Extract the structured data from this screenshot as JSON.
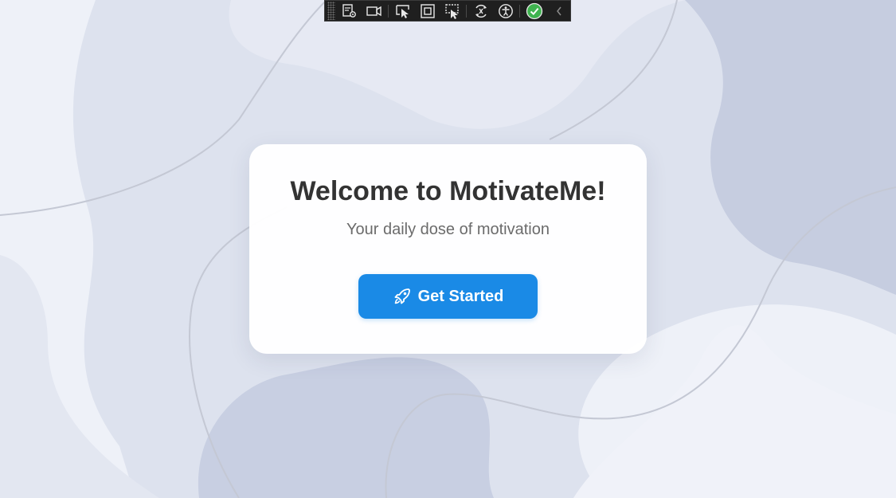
{
  "devtools": {
    "icons": [
      "live-visual-tree-icon",
      "video-capture-icon",
      "select-element-icon",
      "display-layout-adorners-icon",
      "track-focus-icon",
      "hot-reload-icon",
      "accessibility-checker-icon",
      "issues-ok-icon",
      "collapse-toolbar-icon"
    ]
  },
  "card": {
    "title": "Welcome to MotivateMe!",
    "subtitle": "Your daily dose of motivation",
    "button_label": "Get Started",
    "button_icon": "rocket-icon"
  },
  "colors": {
    "background": "#eef1f8",
    "blob_light": "#dde2ee",
    "blob_mid": "#cfd5e6",
    "blob_dark": "#c3cbdf",
    "accent": "#1a8ae6",
    "title": "#333333",
    "subtitle": "#6b6b6b",
    "toolbar": "#1f1f1f",
    "ok_green": "#3fb34f"
  }
}
